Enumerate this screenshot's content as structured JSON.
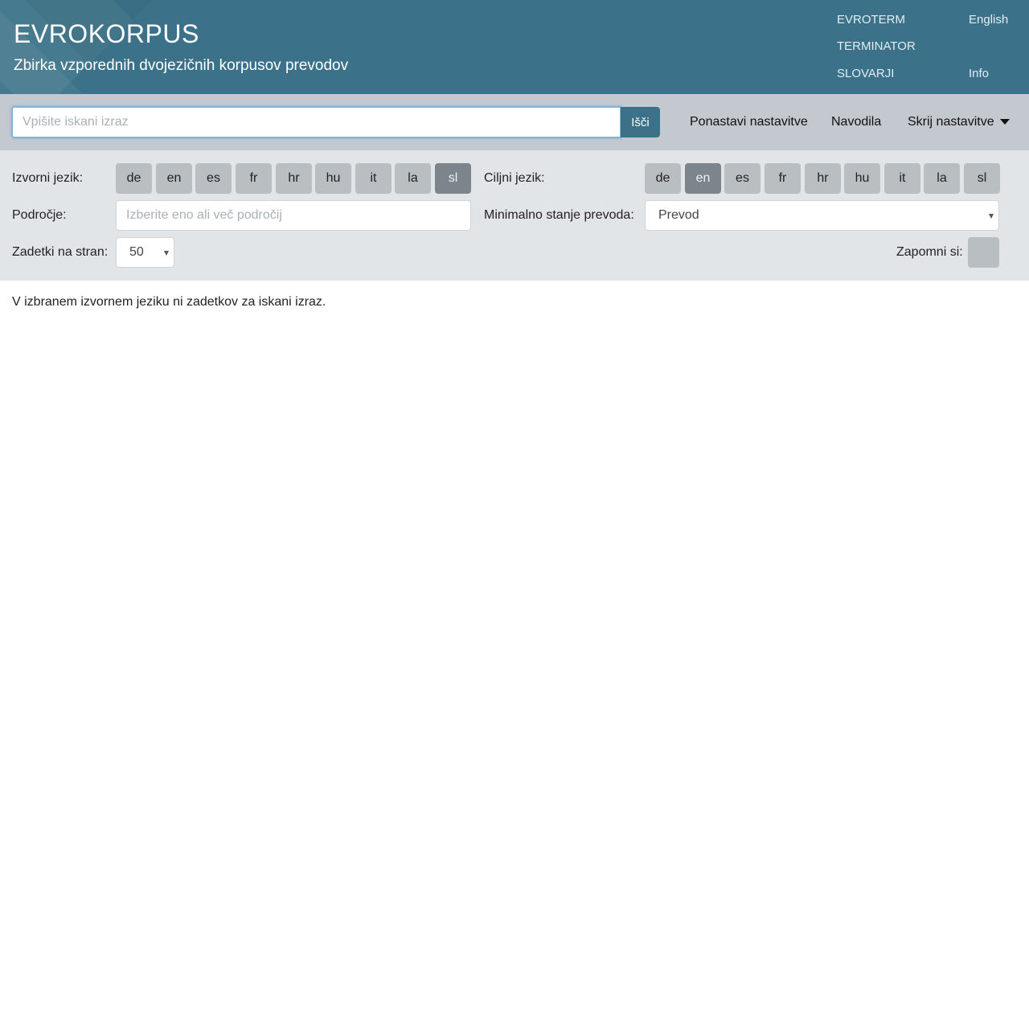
{
  "header": {
    "title": "EVROKORPUS",
    "subtitle": "Zbirka vzporednih dvojezičnih korpusov prevodov",
    "nav": [
      "EVROTERM",
      "TERMINATOR",
      "SLOVARJI"
    ],
    "language_link": "English",
    "info_link": "Info",
    "background_color": "#3b7289"
  },
  "search": {
    "placeholder": "Vpišite iskani izraz",
    "value": "",
    "button_label": "Išči",
    "reset_label": "Ponastavi nastavitve",
    "help_label": "Navodila",
    "toggle_label": "Skrij nastavitve",
    "toggle_icon": "caret-down-icon"
  },
  "settings": {
    "source_label": "Izvorni jezik:",
    "target_label": "Ciljni jezik:",
    "languages": [
      "de",
      "en",
      "es",
      "fr",
      "hr",
      "hu",
      "it",
      "la",
      "sl"
    ],
    "source_selected": "sl",
    "target_selected": "en",
    "domain_label": "Področje:",
    "domain_placeholder": "Izberite eno ali več področij",
    "min_state_label": "Minimalno stanje prevoda:",
    "min_state_value": "Prevod",
    "per_page_label": "Zadetki na stran:",
    "per_page_value": "50",
    "remember_label": "Zapomni si:"
  },
  "result": {
    "message": "V izbranem izvornem jeziku ni zadetkov za iskani izraz."
  }
}
